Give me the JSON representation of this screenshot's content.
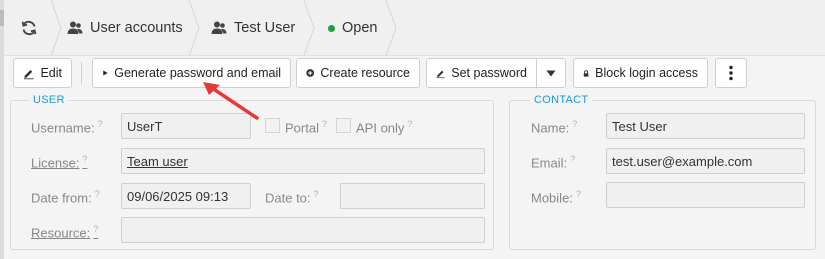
{
  "breadcrumb": {
    "items": [
      {
        "label": "User accounts",
        "icon": "users-icon"
      },
      {
        "label": "Test User",
        "icon": "user-icon"
      },
      {
        "label": "Open",
        "icon": "status-dot-icon"
      }
    ],
    "status_color": "#1aa03a"
  },
  "toolbar": {
    "edit": "Edit",
    "generate": "Generate password and email",
    "create_resource": "Create resource",
    "set_password": "Set password",
    "block_login": "Block login access"
  },
  "user_section": {
    "legend": "USER",
    "username_label": "Username:",
    "username_value": "UserT",
    "portal_label": "Portal",
    "api_only_label": "API only",
    "license_label": "License:",
    "license_value": "Team user",
    "date_from_label": "Date from:",
    "date_from_value": "09/06/2025 09:13",
    "date_to_label": "Date to:",
    "date_to_value": "",
    "resource_label": "Resource:",
    "resource_value": "",
    "help_mark": "?"
  },
  "contact_section": {
    "legend": "CONTACT",
    "name_label": "Name:",
    "name_value": "Test User",
    "email_label": "Email:",
    "email_value": "test.user@example.com",
    "mobile_label": "Mobile:",
    "mobile_value": ""
  },
  "colors": {
    "accent": "#1d9bd1",
    "annotation_arrow": "#e53935"
  }
}
